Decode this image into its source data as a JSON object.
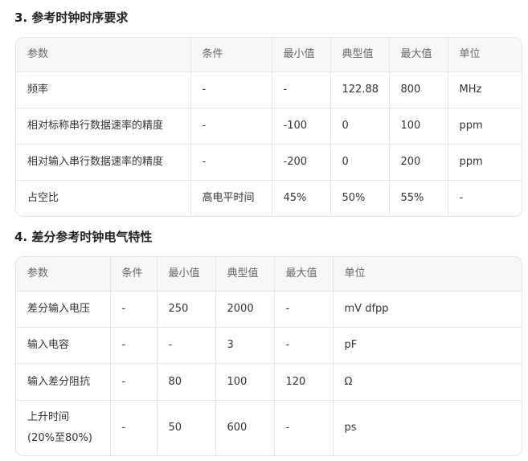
{
  "section3": {
    "title": "3. 参考时钟时序要求",
    "headers": [
      "参数",
      "条件",
      "最小值",
      "典型值",
      "最大值",
      "单位"
    ],
    "rows": [
      [
        "频率",
        "-",
        "-",
        "122.88",
        "800",
        "MHz"
      ],
      [
        "相对标称串行数据速率的精度",
        "-",
        "-100",
        "0",
        "100",
        "ppm"
      ],
      [
        "相对输入串行数据速率的精度",
        "-",
        "-200",
        "0",
        "200",
        "ppm"
      ],
      [
        "占空比",
        "高电平时间",
        "45%",
        "50%",
        "55%",
        "-"
      ]
    ]
  },
  "section4": {
    "title": "4. 差分参考时钟电气特性",
    "headers": [
      "参数",
      "条件",
      "最小值",
      "典型值",
      "最大值",
      "单位"
    ],
    "rows": [
      [
        "差分输入电压",
        "-",
        "250",
        "2000",
        "-",
        "mV dfpp"
      ],
      [
        "输入电容",
        "-",
        "-",
        "3",
        "-",
        "pF"
      ],
      [
        "输入差分阻抗",
        "-",
        "80",
        "100",
        "120",
        "Ω"
      ],
      [
        "上升时间",
        "-",
        "50",
        "600",
        "-",
        "ps"
      ]
    ],
    "row4_param_line2": "(20%至80%)"
  }
}
